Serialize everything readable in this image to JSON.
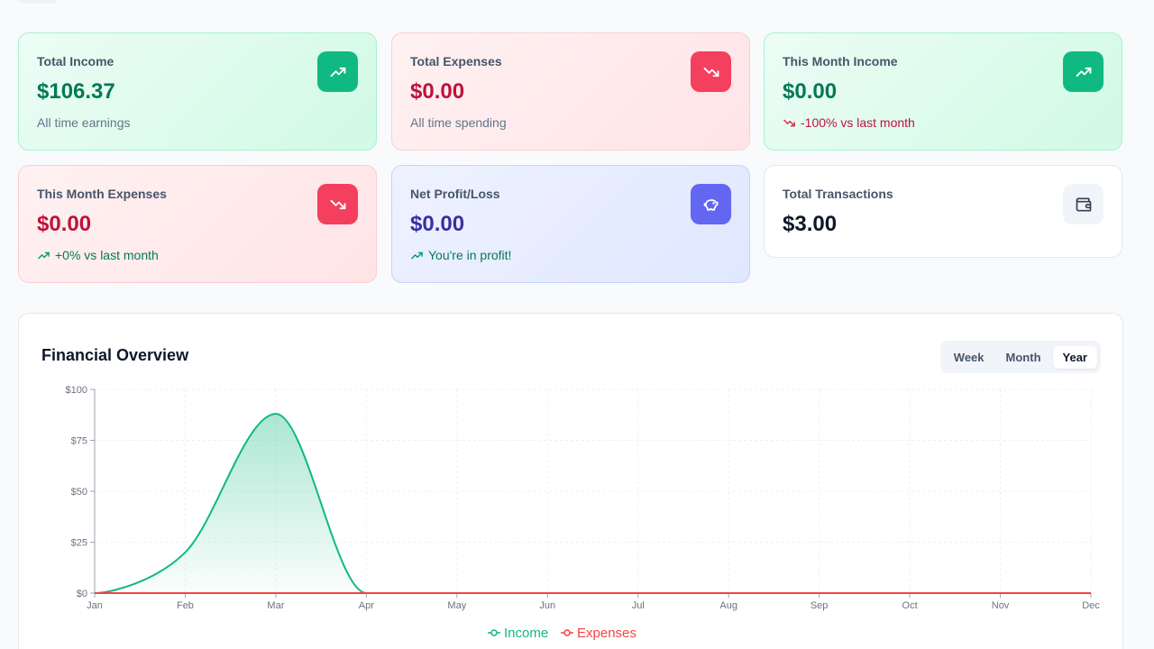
{
  "cards": [
    {
      "title": "Total Income",
      "value": "$106.37",
      "sub": "All time earnings",
      "icon": "trending-up-icon"
    },
    {
      "title": "Total Expenses",
      "value": "$0.00",
      "sub": "All time spending",
      "icon": "trending-down-icon"
    },
    {
      "title": "This Month Income",
      "value": "$0.00",
      "sub": "-100% vs last month",
      "icon": "trending-up-icon"
    },
    {
      "title": "This Month Expenses",
      "value": "$0.00",
      "sub": "+0% vs last month",
      "icon": "trending-down-icon"
    },
    {
      "title": "Net Profit/Loss",
      "value": "$0.00",
      "sub": "You're in profit!",
      "icon": "piggy-bank-icon"
    },
    {
      "title": "Total Transactions",
      "value": "$3.00",
      "icon": "wallet-icon"
    }
  ],
  "overview": {
    "title": "Financial Overview",
    "ranges": [
      "Week",
      "Month",
      "Year"
    ],
    "active_range": "Year"
  },
  "colors": {
    "income": "#10b981",
    "expenses": "#ef4444",
    "green_accent": "#10b981",
    "red_accent": "#f43f5e",
    "indigo_accent": "#6366f1"
  },
  "chart_data": {
    "type": "area",
    "categories": [
      "Jan",
      "Feb",
      "Mar",
      "Apr",
      "May",
      "Jun",
      "Jul",
      "Aug",
      "Sep",
      "Oct",
      "Nov",
      "Dec"
    ],
    "series": [
      {
        "name": "Income",
        "values": [
          0,
          20,
          88,
          0,
          0,
          0,
          0,
          0,
          0,
          0,
          0,
          0
        ]
      },
      {
        "name": "Expenses",
        "values": [
          0,
          0,
          0,
          0,
          0,
          0,
          0,
          0,
          0,
          0,
          0,
          0
        ]
      }
    ],
    "yticks": [
      "$0",
      "$25",
      "$50",
      "$75",
      "$100"
    ],
    "ylim": [
      0,
      100
    ],
    "grid": true,
    "legend": "bottom-center"
  }
}
